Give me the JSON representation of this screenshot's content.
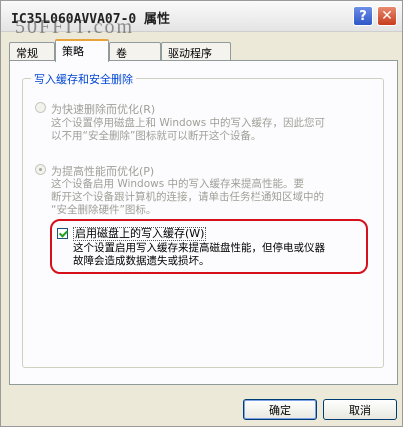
{
  "window": {
    "title": "IC35L060AVVA07-0 属性",
    "watermark": "50FFIT.com",
    "help_glyph": "?",
    "close_glyph": "✕"
  },
  "tabs": [
    {
      "label": "常规",
      "active": false
    },
    {
      "label": "策略",
      "active": true
    },
    {
      "label": "卷",
      "active": false
    },
    {
      "label": "驱动程序",
      "active": false
    }
  ],
  "group": {
    "title": "写入缓存和安全删除",
    "option_quick": {
      "label": "为快速删除而优化(R)",
      "checked": false,
      "desc": [
        "这个设置停用磁盘上和 Windows 中的写入缓存，因此您可",
        "以不用“安全删除”图标就可以断开这个设备。"
      ]
    },
    "option_perf": {
      "label": "为提高性能而优化(P)",
      "checked": true,
      "desc": [
        "这个设备启用 Windows 中的写入缓存来提高性能。要",
        "断开这个设备跟计算机的连接，请单击任务栏通知区域中的",
        "“安全删除硬件”图标。"
      ]
    },
    "write_cache": {
      "label": "启用磁盘上的写入缓存(W)",
      "checked": true,
      "desc": [
        "这个设置启用写入缓存来提高磁盘性能，但停电或仪器",
        "故障会造成数据遗失或损坏。"
      ]
    }
  },
  "buttons": {
    "ok": "确定",
    "cancel": "取消"
  },
  "colors": {
    "group_title": "#0046d5",
    "highlight": "#d6101b",
    "tab_active_accent": "#e6a33a"
  }
}
